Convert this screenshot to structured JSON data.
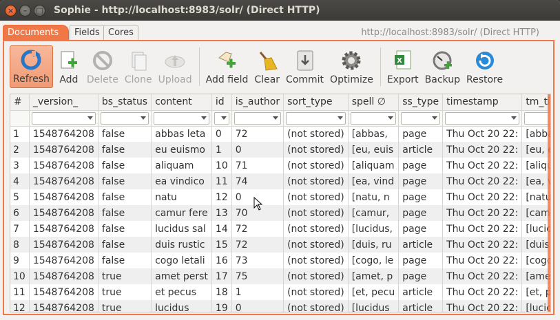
{
  "window": {
    "title": "Sophie - http://localhost:8983/solr/ (Direct HTTP)",
    "close_glyph": "×",
    "min_glyph": "–",
    "max_glyph": "□"
  },
  "tabs": [
    {
      "label": "Documents",
      "active": true
    },
    {
      "label": "Fields",
      "active": false
    },
    {
      "label": "Cores",
      "active": false
    }
  ],
  "url_label": "http://localhost:8983/solr/ (Direct HTTP)",
  "toolbar": {
    "refresh": "Refresh",
    "add": "Add",
    "delete": "Delete",
    "clone": "Clone",
    "upload": "Upload",
    "add_field": "Add field",
    "clear": "Clear",
    "commit": "Commit",
    "optimize": "Optimize",
    "export": "Export",
    "backup": "Backup",
    "restore": "Restore"
  },
  "colors": {
    "accent": "#f07746",
    "refresh_blue": "#2a76c6",
    "add_green": "#3fa535"
  },
  "table": {
    "columns": [
      "#",
      "_version_",
      "bs_status",
      "content",
      "id",
      "is_author",
      "sort_type",
      "spell ∅",
      "ss_type",
      "timestamp",
      "tm_title"
    ],
    "rows": [
      [
        "1",
        "1548764208",
        "false",
        "abbas leta",
        "0",
        "72",
        "(not stored)",
        "[abbas,",
        "page",
        "Thu Oct 20 22:",
        "[abbas,"
      ],
      [
        "2",
        "1548764208",
        "false",
        "eu euismo",
        "1",
        "0",
        "(not stored)",
        "[eu, euis",
        "article",
        "Thu Oct 20 22:",
        "[eu, euis"
      ],
      [
        "3",
        "1548764208",
        "false",
        "aliquam",
        "10",
        "71",
        "(not stored)",
        "[aliquam",
        "page",
        "Thu Oct 20 22:",
        "[aliquam"
      ],
      [
        "4",
        "1548764208",
        "false",
        "ea vindico",
        "11",
        "74",
        "(not stored)",
        "[ea, vind",
        "page",
        "Thu Oct 20 22:",
        "[ea, vind"
      ],
      [
        "5",
        "1548764208",
        "false",
        "natu",
        "12",
        "0",
        "(not stored)",
        "[natu, n",
        "page",
        "Thu Oct 20 22:",
        "[natu]"
      ],
      [
        "6",
        "1548764208",
        "false",
        "camur fere",
        "13",
        "70",
        "(not stored)",
        "[camur,",
        "page",
        "Thu Oct 20 22:",
        "[camur,"
      ],
      [
        "7",
        "1548764208",
        "false",
        "lucidus sal",
        "14",
        "72",
        "(not stored)",
        "[lucidus,",
        "page",
        "Thu Oct 20 22:",
        "[lucidus,"
      ],
      [
        "8",
        "1548764208",
        "false",
        "duis rustic",
        "15",
        "72",
        "(not stored)",
        "[duis, ru",
        "article",
        "Thu Oct 20 22:",
        "[duis, ru"
      ],
      [
        "9",
        "1548764208",
        "false",
        "cogo letali",
        "16",
        "73",
        "(not stored)",
        "[cogo, le",
        "page",
        "Thu Oct 20 22:",
        "[cogo, le"
      ],
      [
        "10",
        "1548764208",
        "true",
        "amet perst",
        "17",
        "75",
        "(not stored)",
        "[amet, p",
        "page",
        "Thu Oct 20 22:",
        "[amet, p"
      ],
      [
        "11",
        "1548764208",
        "true",
        "et pecus",
        "18",
        "1",
        "(not stored)",
        "[et, pecu",
        "article",
        "Thu Oct 20 22:",
        "[et, pecu"
      ],
      [
        "12",
        "1548764208",
        "true",
        "lucidus",
        "19",
        "0",
        "(not stored)",
        "[lucidus",
        "article",
        "Thu Oct 20 22:",
        "[lucidus]"
      ]
    ]
  }
}
